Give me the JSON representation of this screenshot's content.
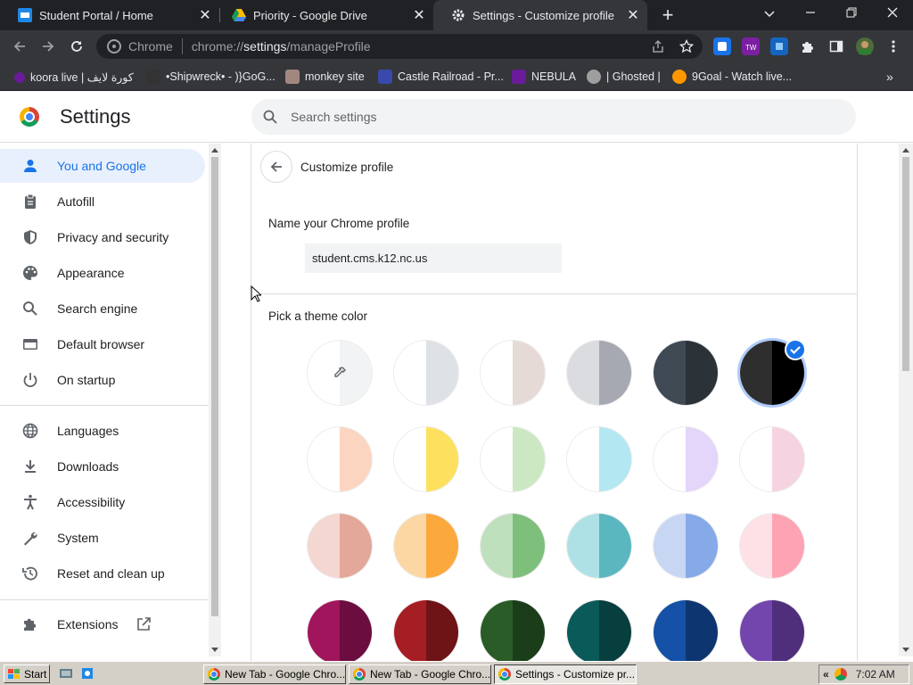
{
  "tabs": [
    {
      "title": "Student Portal / Home",
      "icon": "portal-icon"
    },
    {
      "title": "Priority - Google Drive",
      "icon": "drive-icon"
    },
    {
      "title": "Settings - Customize profile",
      "icon": "settings-gear-icon",
      "active": true
    }
  ],
  "toolbar": {
    "origin_chip": "Chrome",
    "url_prefix": "chrome://",
    "url_host": "settings",
    "url_path": "/manageProfile"
  },
  "bookmarks": [
    {
      "label": "koora live | كورة لايف",
      "icon": "koora-icon",
      "color": "#6a1b9a"
    },
    {
      "label": "•Shipwreck• - )}GoG...",
      "icon": "shipwreck-icon",
      "color": "#333333"
    },
    {
      "label": "monkey site",
      "icon": "monkey-icon",
      "color": "#8d6e63"
    },
    {
      "label": "Castle Railroad - Pr...",
      "icon": "castle-icon",
      "color": "#3949ab"
    },
    {
      "label": "NEBULA",
      "icon": "nebula-icon",
      "color": "#6a1b9a"
    },
    {
      "label": "| Ghosted |",
      "icon": "ghost-icon",
      "color": "#9e9e9e"
    },
    {
      "label": "9Goal - Watch live...",
      "icon": "9goal-icon",
      "color": "#ff9800"
    }
  ],
  "header": {
    "title": "Settings",
    "search_placeholder": "Search settings"
  },
  "sidebar": {
    "items": [
      {
        "label": "You and Google",
        "icon": "person-icon",
        "active": true
      },
      {
        "label": "Autofill",
        "icon": "clipboard-icon"
      },
      {
        "label": "Privacy and security",
        "icon": "shield-icon"
      },
      {
        "label": "Appearance",
        "icon": "palette-icon"
      },
      {
        "label": "Search engine",
        "icon": "search-icon"
      },
      {
        "label": "Default browser",
        "icon": "browser-icon"
      },
      {
        "label": "On startup",
        "icon": "power-icon"
      },
      {
        "label": "Languages",
        "icon": "globe-icon"
      },
      {
        "label": "Downloads",
        "icon": "download-icon"
      },
      {
        "label": "Accessibility",
        "icon": "accessibility-icon"
      },
      {
        "label": "System",
        "icon": "wrench-icon"
      },
      {
        "label": "Reset and clean up",
        "icon": "history-icon"
      },
      {
        "label": "Extensions",
        "icon": "puzzle-icon"
      }
    ]
  },
  "page": {
    "subtitle": "Customize profile",
    "name_heading": "Name your Chrome profile",
    "profile_name": "student.cms.k12.nc.us",
    "theme_heading": "Pick a theme color"
  },
  "theme_colors": [
    [
      [
        "#ffffff",
        "#f1f3f4"
      ],
      [
        "#ffffff",
        "#dee1e6"
      ],
      [
        "#ffffff",
        "#e6dad7"
      ],
      [
        "#dadce0",
        "#a6a9b2"
      ],
      [
        "#3f4a55",
        "#2b3238"
      ],
      [
        "#2e2e2e",
        "#000000"
      ]
    ],
    [
      [
        "#ffffff",
        "#fcd5c1"
      ],
      [
        "#ffffff",
        "#fde15e"
      ],
      [
        "#ffffff",
        "#cbe8c2"
      ],
      [
        "#ffffff",
        "#b3e7f2"
      ],
      [
        "#ffffff",
        "#e4d5fa"
      ],
      [
        "#ffffff",
        "#f6d3e1"
      ]
    ],
    [
      [
        "#f4d7d1",
        "#e3a899"
      ],
      [
        "#fcd7a3",
        "#fba83c"
      ],
      [
        "#bfe0bd",
        "#7ebf7b"
      ],
      [
        "#aee1e5",
        "#5ab7c0"
      ],
      [
        "#c7d7f3",
        "#86a9e8"
      ],
      [
        "#fde1e6",
        "#fda3b4"
      ]
    ],
    [
      [
        "#a0155c",
        "#6b0d3e"
      ],
      [
        "#a51e23",
        "#6e1316"
      ],
      [
        "#295c26",
        "#1b3d19"
      ],
      [
        "#0a5a5a",
        "#073e3e"
      ],
      [
        "#1551a6",
        "#0d3670"
      ],
      [
        "#7346ad",
        "#4f2e7c"
      ]
    ]
  ],
  "selected_theme": "Black",
  "taskbar": {
    "start_label": "Start",
    "tasks": [
      {
        "title": "New Tab - Google Chro..."
      },
      {
        "title": "New Tab - Google Chro..."
      },
      {
        "title": "Settings - Customize pr...",
        "active": true
      }
    ],
    "clock": "7:02 AM"
  }
}
